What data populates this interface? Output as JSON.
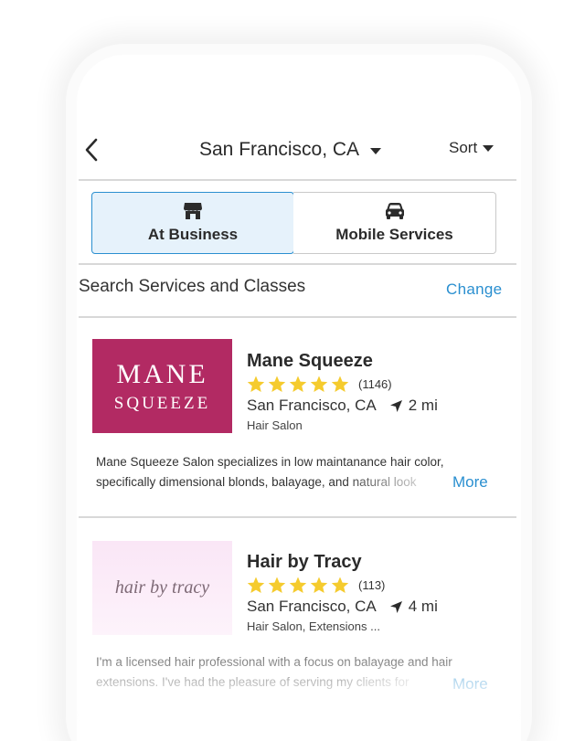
{
  "header": {
    "back_icon": "chevron-left-icon",
    "location": "San Francisco, CA",
    "sort_label": "Sort"
  },
  "tabs": [
    {
      "label": "At Business",
      "icon": "storefront-icon",
      "selected": true
    },
    {
      "label": "Mobile Services",
      "icon": "car-icon",
      "selected": false
    }
  ],
  "search": {
    "label": "Search Services and Classes",
    "change_label": "Change"
  },
  "listings": [
    {
      "logo_line1": "MANE",
      "logo_line2": "SQUEEZE",
      "logo_color": "#b22a63",
      "name": "Mane Squeeze",
      "rating": 5,
      "review_count": "(1146)",
      "city": "San Francisco, CA",
      "distance": "2 mi",
      "category": "Hair Salon",
      "description_line1": "Mane Squeeze Salon specializes in low maintanance hair color,",
      "description_line2": "specifically dimensional blonds, balayage, and natural look",
      "more_label": "More"
    },
    {
      "logo_text": "hair by tracy",
      "name": "Hair by Tracy",
      "rating": 5,
      "review_count": "(113)",
      "city": "San Francisco, CA",
      "distance": "4 mi",
      "category": "Hair Salon, Extensions ...",
      "description_line1": "I'm a licensed hair professional with a focus on balayage and hair",
      "description_line2": "extensions. I've had the pleasure of serving my clients for",
      "more_label": "More"
    }
  ],
  "colors": {
    "accent": "#2a8fd0",
    "star": "#f5cb2e",
    "selected_tab_bg": "#e6f2fb"
  }
}
